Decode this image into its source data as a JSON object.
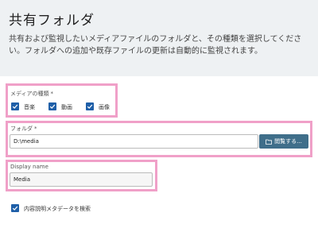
{
  "page": {
    "title": "共有フォルダ",
    "description_line1": "共有および監視したいメディアファイルのフォルダと、その種類を選択してくださ",
    "description_line2": "い。フォルダへの追加や既存ファイルの更新は自動的に監視されます。"
  },
  "media_types": {
    "label": "メディアの種類",
    "required_mark": "*",
    "options": [
      {
        "label": "音楽",
        "checked": true
      },
      {
        "label": "動画",
        "checked": true
      },
      {
        "label": "画像",
        "checked": true
      }
    ]
  },
  "folder": {
    "label": "フォルダ",
    "required_mark": "*",
    "value": "D:\\media",
    "browse_label": "閲覧する..."
  },
  "display_name": {
    "label": "Display name",
    "value": "Media"
  },
  "metadata_option": {
    "label": "内容説明メタデータを検索",
    "checked": true
  },
  "colors": {
    "accent": "#1f5fa8",
    "browse_button": "#3f6e8a",
    "highlight": "#f0a0c8",
    "header_bg": "#eef1f3"
  }
}
